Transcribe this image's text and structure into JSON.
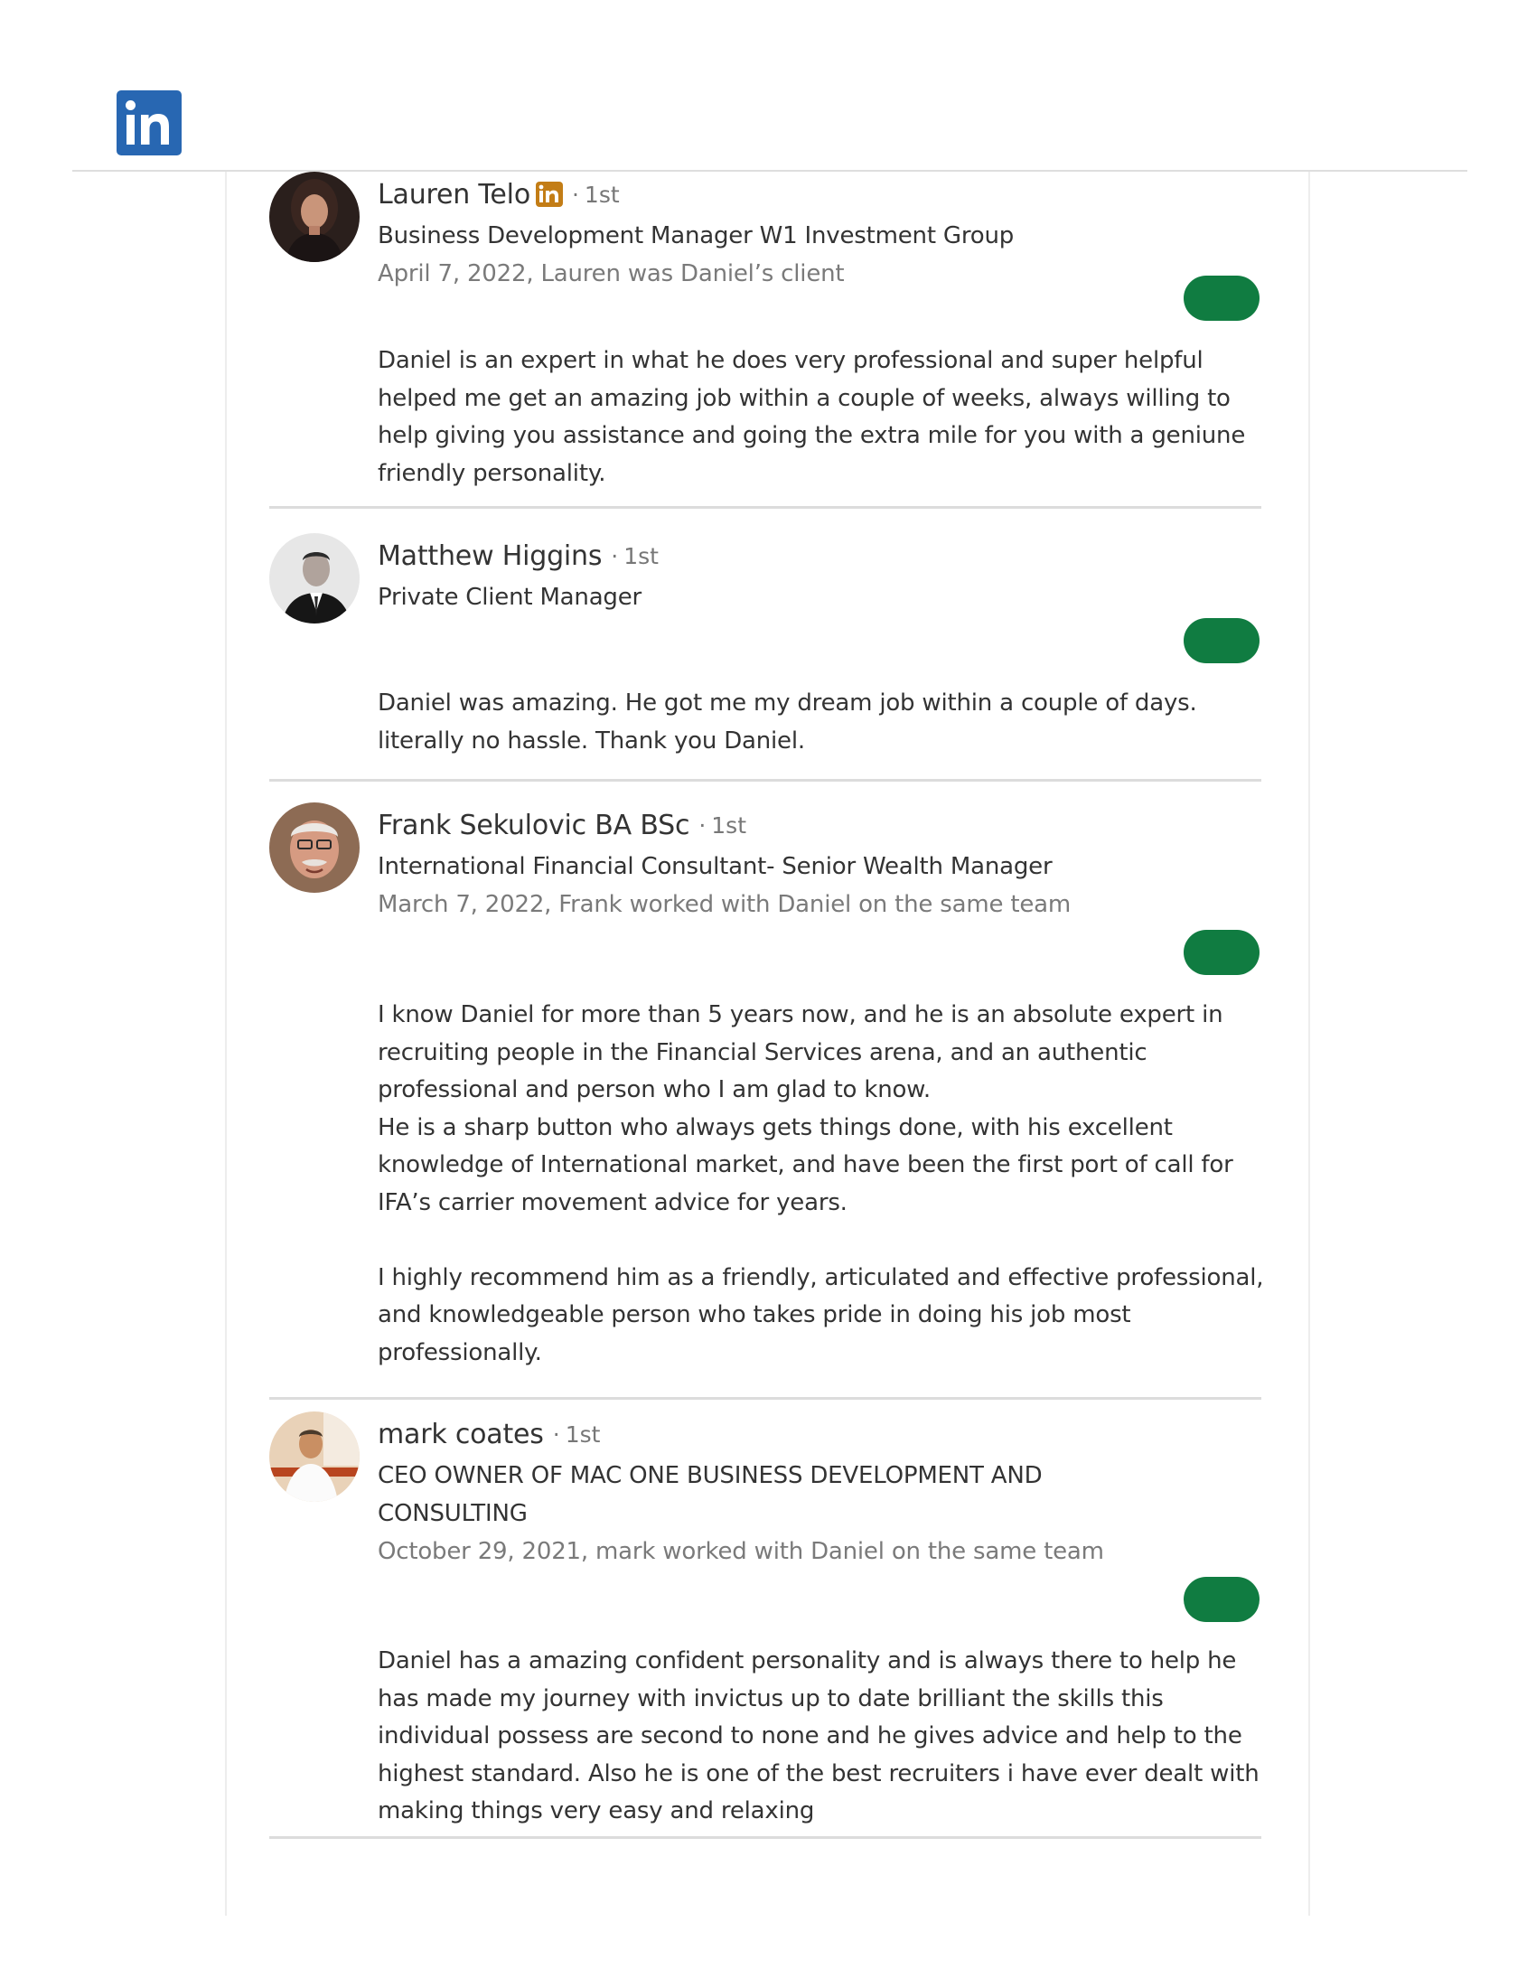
{
  "brand": {
    "logo_icon": "linkedin-logo-icon",
    "logo_color": "#2867b2",
    "badge_color": "#c37d16",
    "pill_color": "#107c41"
  },
  "recommendations": [
    {
      "name": "Lauren Telo",
      "has_linkedin_badge": true,
      "degree": "1st",
      "degree_separator": "·",
      "title": "Business Development Manager W1 Investment Group",
      "date_relationship": "April 7, 2022, Lauren was Daniel’s client",
      "text": [
        "Daniel is an expert in what he does very professional and super helpful helped me get an amazing job within a couple of weeks, always willing to help giving you assistance and going the extra mile for you with a geniune friendly personality."
      ]
    },
    {
      "name": "Matthew Higgins",
      "has_linkedin_badge": false,
      "degree": "1st",
      "degree_separator": "·",
      "title": "Private Client Manager",
      "date_relationship": "",
      "text": [
        "Daniel was amazing. He got me my dream job within a couple of days. literally no hassle. Thank you Daniel."
      ]
    },
    {
      "name": "Frank Sekulovic BA BSc",
      "has_linkedin_badge": false,
      "degree": "1st",
      "degree_separator": "·",
      "title": "International Financial Consultant- Senior Wealth Manager",
      "date_relationship": "March 7, 2022, Frank worked with Daniel on the same team",
      "text": [
        "I know Daniel for more than 5 years now, and he is an absolute expert in recruiting people in the Financial Services arena, and an authentic professional and person who I am glad to know.",
        "He is a sharp button who always gets things done, with his excellent knowledge of International market, and have been the first port of call for IFA’s carrier movement advice for years.",
        "I highly recommend him as a friendly, articulated and effective professional, and knowledgeable person who takes pride in doing his job most professionally."
      ]
    },
    {
      "name": "mark coates",
      "has_linkedin_badge": false,
      "degree": "1st",
      "degree_separator": "·",
      "title": "CEO OWNER OF MAC ONE BUSINESS DEVELOPMENT AND CONSULTING",
      "date_relationship": "October 29, 2021, mark worked with Daniel on the same team",
      "text": [
        "Daniel has a amazing confident personality and is always there to help he has made my journey with invictus up to date brilliant the skills this individual possess are second to none and he gives advice and help to the highest standard. Also he is one of the best recruiters i have ever dealt with making things very easy and relaxing"
      ]
    }
  ]
}
